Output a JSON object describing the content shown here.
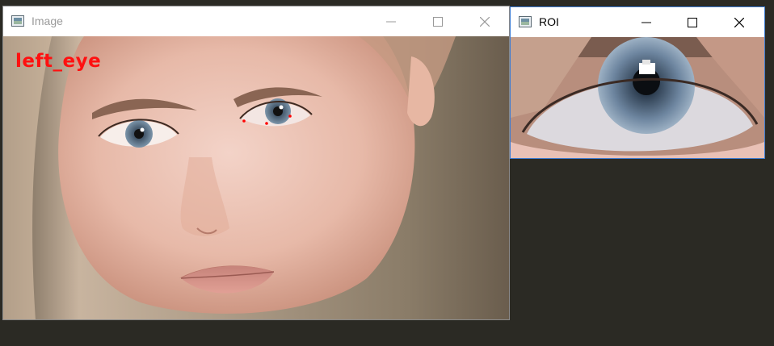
{
  "windows": {
    "image": {
      "title": "Image",
      "overlay_text": "left_eye",
      "controls": {
        "minimize": "minimize-icon",
        "maximize": "maximize-icon",
        "close": "close-icon"
      }
    },
    "roi": {
      "title": "ROI",
      "controls": {
        "minimize": "minimize-icon",
        "maximize": "maximize-icon",
        "close": "close-icon"
      }
    }
  },
  "colors": {
    "desktop": "#2b2a24",
    "overlay_text": "#ff1010",
    "landmark_points": "#ff0000",
    "roi_border": "#3c7bd1"
  }
}
